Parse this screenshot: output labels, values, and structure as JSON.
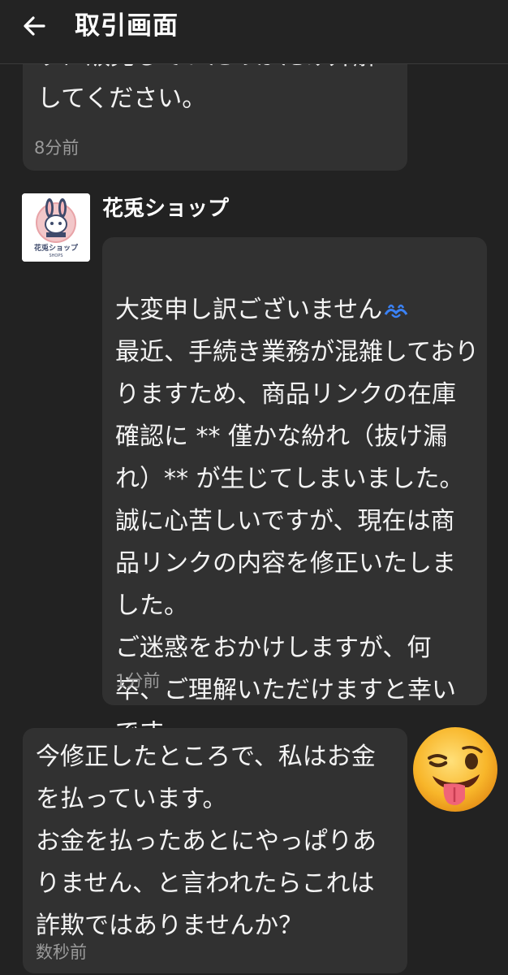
{
  "header": {
    "title": "取引画面",
    "back_icon": "arrow-left-icon"
  },
  "messages": [
    {
      "sender": "me",
      "clipped_top_text": "すに販売していたのかだけ弁解",
      "text": "してください。",
      "time": "8分前"
    },
    {
      "sender": "shop",
      "shop_name": "花兎ショップ",
      "avatar_text": "花兎ショップ",
      "avatar_subtext": "SHOPS",
      "text_line1": "大変申し訳ございません",
      "text_rest": "最近、手続き業務が混雑しており\nりますため、商品リンクの在庫\n確認に ** 僅かな紛れ（抜け漏\nれ）** が生じてしまいました。\n誠に心苦しいですが、現在は商\n品リンクの内容を修正いたしま\nした。\nご迷惑をおかけしますが、何\n卒、ご理解いただけますと幸い\nです。",
      "emoji": "weary-tears-emoji",
      "time": "1分前"
    },
    {
      "sender": "me",
      "text": "今修正したところで、私はお金\nを払っています。\nお金を払ったあとにやっぱりあ\nりません、と言われたらこれは\n詐欺ではありませんか？",
      "time": "数秒前",
      "reaction": "winking-tongue-emoji"
    }
  ],
  "colors": {
    "background": "#222222",
    "bubble": "#313131",
    "time": "#9a9a9a",
    "text": "#f4f4f4"
  }
}
